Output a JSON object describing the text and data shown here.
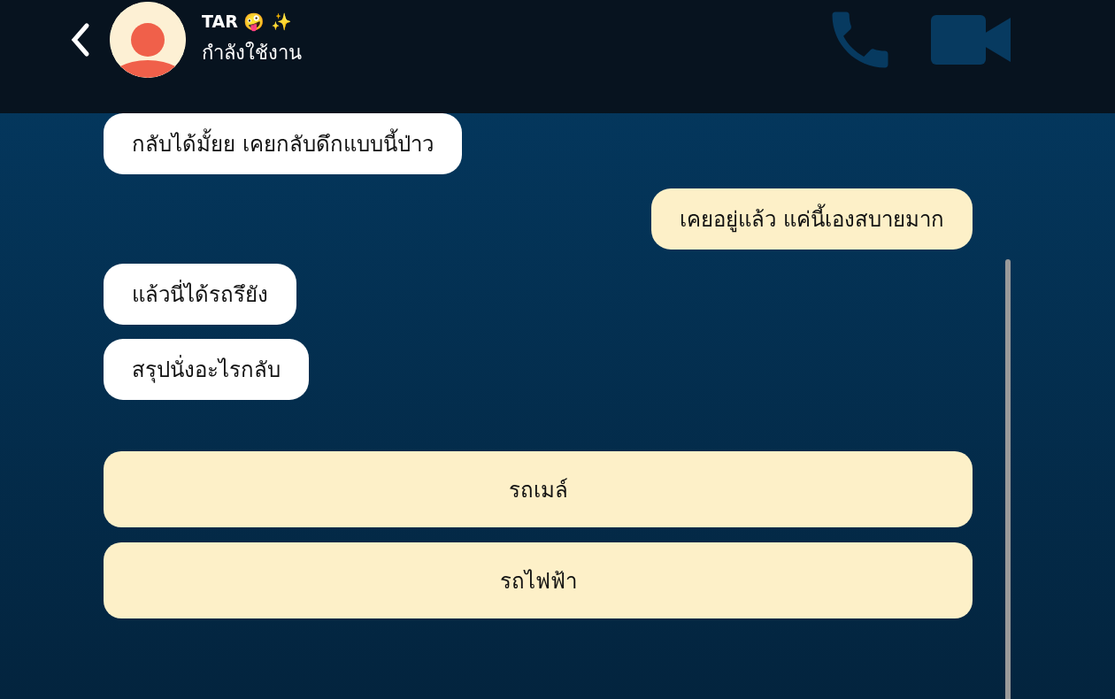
{
  "header": {
    "name": "TAR 🤪 ✨",
    "status": "กำลังใช้งาน"
  },
  "messages": [
    {
      "kind": "incoming",
      "text": "กลับได้มั้ยย เคยกลับดึกแบบนี้ป่าว"
    },
    {
      "kind": "outgoing",
      "text": "เคยอยู่แล้ว แค่นี้เองสบายมาก"
    },
    {
      "kind": "incoming",
      "text": "แล้วนี่ได้รถรึยัง"
    },
    {
      "kind": "incoming",
      "text": "สรุปนั่งอะไรกลับ"
    }
  ],
  "choices": [
    "รถเมล์",
    "รถไฟฟ้า"
  ]
}
